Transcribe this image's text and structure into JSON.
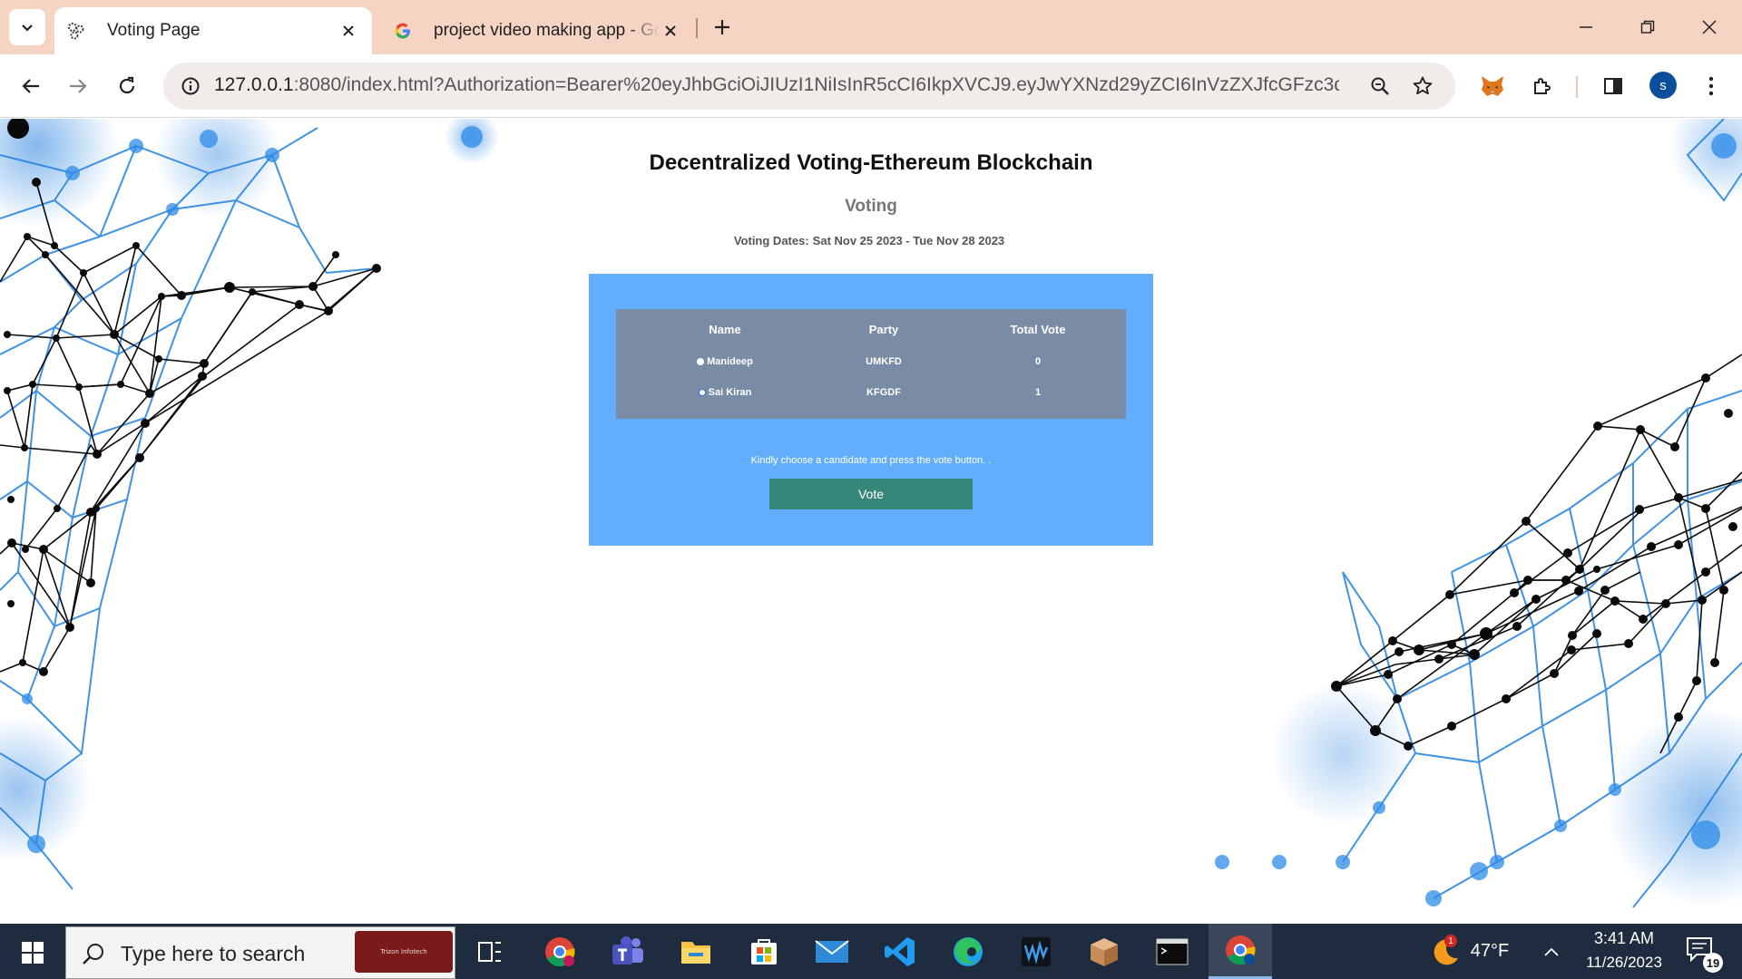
{
  "browser": {
    "tabs": [
      {
        "title": "Voting Page",
        "active": true,
        "favicon": "gear-cluster-icon"
      },
      {
        "title": "project video making app - Goo",
        "active": false,
        "favicon": "google-g-icon"
      }
    ],
    "url_host": "127.0.0.1",
    "url_rest": ":8080/index.html?Authorization=Bearer%20eyJhbGciOiJIUzI1NiIsInR5cCI6IkpXVCJ9.eyJwYXNzd29yZCI6InVzZXJfcGFzc3dvcmQi...",
    "profile_initial": "s",
    "icons": [
      "back-icon",
      "forward-icon",
      "reload-icon",
      "site-info-icon",
      "zoom-icon",
      "bookmark-star-icon",
      "metamask-fox-icon",
      "extensions-icon",
      "side-panel-icon",
      "more-menu-icon"
    ]
  },
  "page": {
    "title": "Decentralized Voting-Ethereum Blockchain",
    "subtitle": "Voting",
    "dates_label": "Voting Dates:",
    "dates_value": "Sat Nov 25 2023 - Tue Nov 28 2023",
    "table": {
      "headers": [
        "Name",
        "Party",
        "Total Vote"
      ],
      "rows": [
        {
          "name": "Manideep",
          "party": "UMKFD",
          "votes": "0",
          "selected": true
        },
        {
          "name": "Sai Kiran",
          "party": "KFGDF",
          "votes": "1",
          "selected": false
        }
      ]
    },
    "instruction": "Kindly choose a candidate and press the vote button. .",
    "vote_button": "Vote"
  },
  "taskbar": {
    "search_placeholder": "Type here to search",
    "promo_text": "Trizon Infotech",
    "apps": [
      "task-view",
      "chrome",
      "teams",
      "file-explorer",
      "microsoft-store",
      "mail",
      "vscode",
      "edge",
      "wavesurfer",
      "sandbox",
      "terminal",
      "chrome-active"
    ],
    "weather_temp": "47°F",
    "weather_badge": "1",
    "time": "3:41 AM",
    "date": "11/26/2023",
    "notification_count": "19"
  }
}
